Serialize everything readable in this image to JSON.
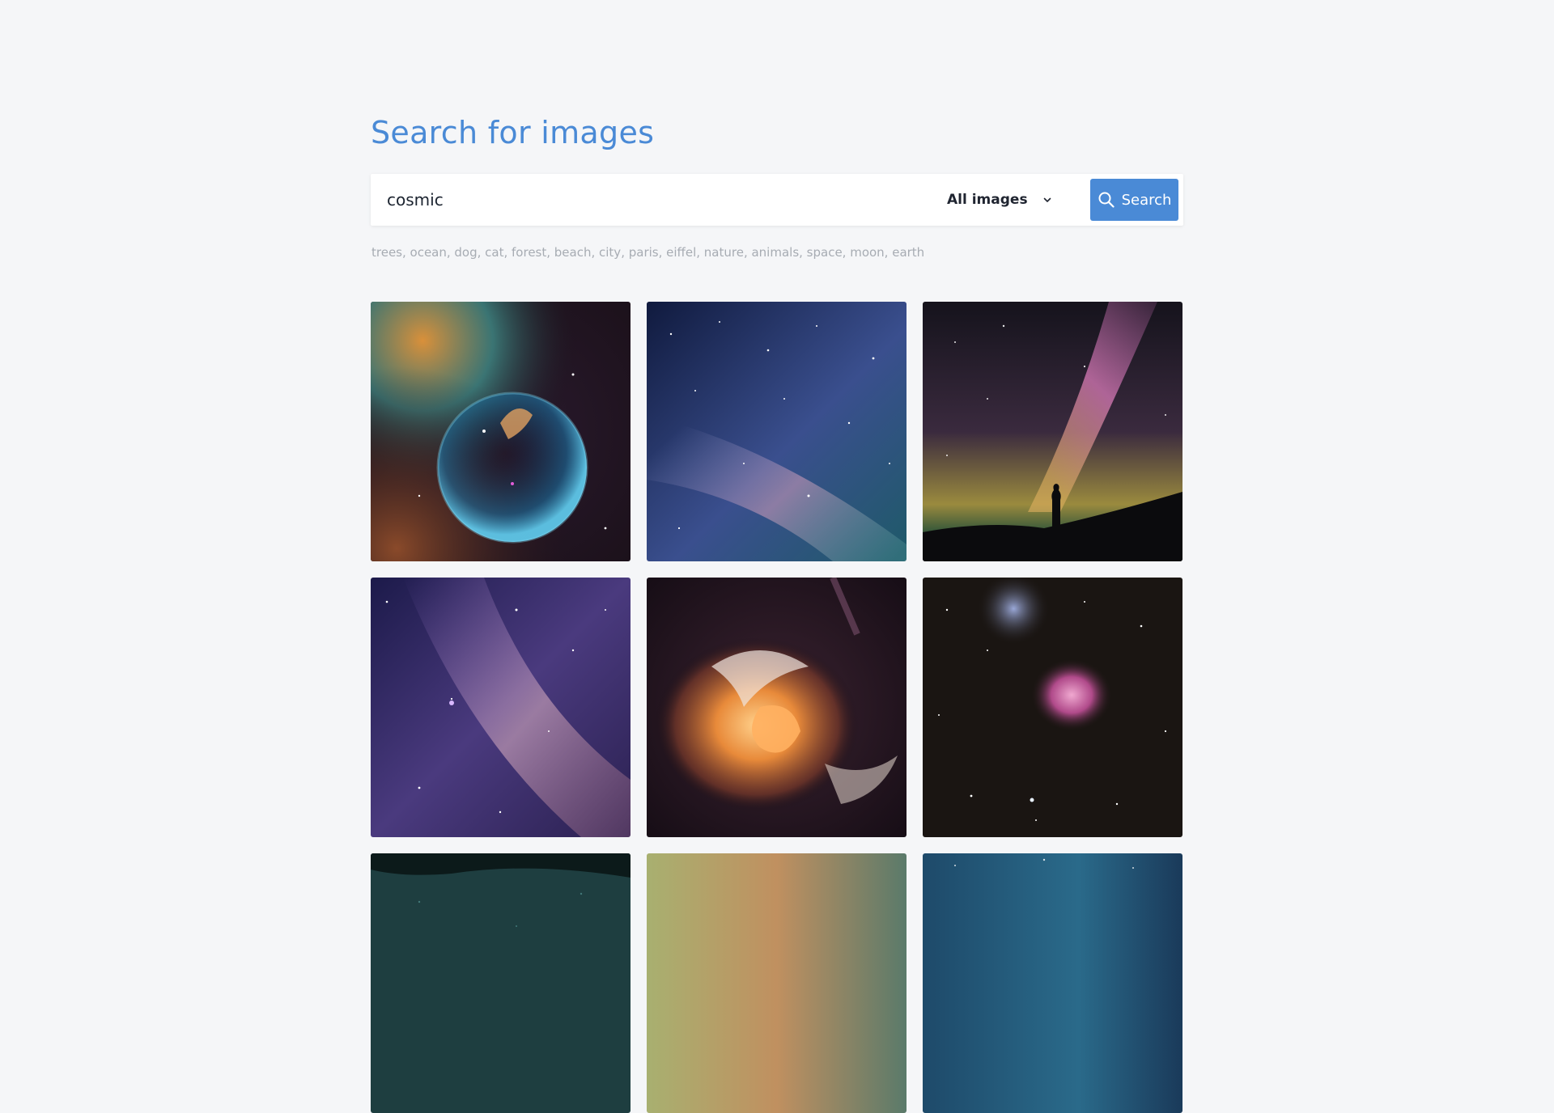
{
  "page": {
    "title": "Search for images"
  },
  "search": {
    "query": "cosmic",
    "filter_label": "All images",
    "button_label": "Search"
  },
  "suggestions": {
    "text": "trees, ocean, dog, cat, forest, beach, city, paris, eiffel, nature, animals, space, moon, earth"
  },
  "results": [
    {
      "subject": "bubble nebula"
    },
    {
      "subject": "milky way starfield"
    },
    {
      "subject": "person under milky way"
    },
    {
      "subject": "purple starfield"
    },
    {
      "subject": "orange fluid swirl"
    },
    {
      "subject": "orion nebula"
    },
    {
      "subject": "teal forest sky"
    },
    {
      "subject": "golden nebula"
    },
    {
      "subject": "blue starry sky"
    }
  ],
  "colors": {
    "accent": "#4a8ad6",
    "background": "#f5f6f8",
    "suggestion_text": "#a7acb3"
  },
  "icons": {
    "search": "search-icon",
    "dropdown": "chevron-down-icon"
  }
}
